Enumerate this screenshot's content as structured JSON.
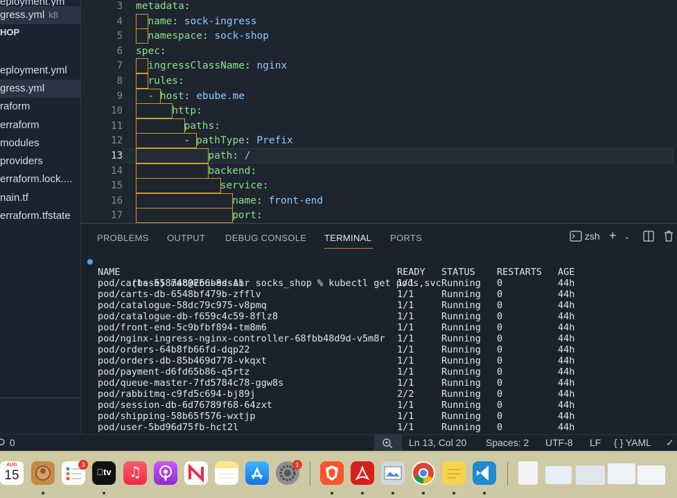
{
  "sidebar": {
    "section": "HOP",
    "items": [
      {
        "label": "eployment.ym",
        "active": false
      },
      {
        "label": "gress.yml",
        "tag": "k8",
        "active": true
      },
      {
        "label": "eployment.yml",
        "active": false
      },
      {
        "label": "gress.yml",
        "active": true
      },
      {
        "label": "raform",
        "active": false
      },
      {
        "label": "erraform",
        "active": false
      },
      {
        "label": "modules",
        "active": false
      },
      {
        "label": "providers",
        "active": false
      },
      {
        "label": "erraform.lock....",
        "active": false
      },
      {
        "label": "nain.tf",
        "active": false
      },
      {
        "label": "erraform.tfstate",
        "active": false
      }
    ]
  },
  "editor": {
    "line_numbers": [
      "3",
      "4",
      "5",
      "6",
      "7",
      "8",
      "9",
      "10",
      "11",
      "12",
      "13",
      "14",
      "15",
      "16",
      "17"
    ],
    "current_line": "13",
    "lines": [
      {
        "prefix": "",
        "key": "metadata",
        "value": ""
      },
      {
        "prefix": "",
        "key": "name",
        "value": "sock-ingress"
      },
      {
        "prefix": "",
        "key": "namespace",
        "value": "sock-shop"
      },
      {
        "prefix": "",
        "key": "spec",
        "value": ""
      },
      {
        "prefix": "",
        "key": "ingressClassName",
        "value": "nginx"
      },
      {
        "prefix": "",
        "key": "rules",
        "value": ""
      },
      {
        "prefix": "- ",
        "key": "host",
        "value": "ebube.me"
      },
      {
        "prefix": "",
        "key": "http",
        "value": ""
      },
      {
        "prefix": "",
        "key": "paths",
        "value": ""
      },
      {
        "prefix": "- ",
        "key": "pathType",
        "value": "Prefix"
      },
      {
        "prefix": "",
        "key": "path",
        "value": "/"
      },
      {
        "prefix": "",
        "key": "backend",
        "value": ""
      },
      {
        "prefix": "",
        "key": "service",
        "value": ""
      },
      {
        "prefix": "",
        "key": "name",
        "value": "front-end"
      },
      {
        "prefix": "",
        "key": "port",
        "value": ""
      }
    ]
  },
  "panel": {
    "tabs": [
      "PROBLEMS",
      "OUTPUT",
      "DEBUG CONSOLE",
      "TERMINAL",
      "PORTS"
    ],
    "active_tab": "TERMINAL",
    "shell": "zsh"
  },
  "terminal": {
    "prompt": "(base) mac@Ebubes-Air socks_shop % kubectl get pods,svc",
    "header": {
      "name": "NAME",
      "ready": "READY",
      "status": "STATUS",
      "restarts": "RESTARTS",
      "age": "AGE"
    },
    "rows": [
      {
        "name": "pod/carts-5587489766-8dssh",
        "ready": "1/1",
        "status": "Running",
        "restarts": "0",
        "age": "44h"
      },
      {
        "name": "pod/carts-db-6548bf479b-zfflv",
        "ready": "1/1",
        "status": "Running",
        "restarts": "0",
        "age": "44h"
      },
      {
        "name": "pod/catalogue-58dc79c975-v8pmq",
        "ready": "1/1",
        "status": "Running",
        "restarts": "0",
        "age": "44h"
      },
      {
        "name": "pod/catalogue-db-f659c4c59-8flz8",
        "ready": "1/1",
        "status": "Running",
        "restarts": "0",
        "age": "44h"
      },
      {
        "name": "pod/front-end-5c9bfbf894-tm8m6",
        "ready": "1/1",
        "status": "Running",
        "restarts": "0",
        "age": "44h"
      },
      {
        "name": "pod/nginx-ingress-nginx-controller-68fbb48d9d-v5m8r",
        "ready": "1/1",
        "status": "Running",
        "restarts": "0",
        "age": "44h"
      },
      {
        "name": "pod/orders-64b8fb66fd-dqp22",
        "ready": "1/1",
        "status": "Running",
        "restarts": "0",
        "age": "44h"
      },
      {
        "name": "pod/orders-db-85b469d778-vkqxt",
        "ready": "1/1",
        "status": "Running",
        "restarts": "0",
        "age": "44h"
      },
      {
        "name": "pod/payment-d6fd65b86-q5rtz",
        "ready": "1/1",
        "status": "Running",
        "restarts": "0",
        "age": "44h"
      },
      {
        "name": "pod/queue-master-7fd5784c78-ggw8s",
        "ready": "1/1",
        "status": "Running",
        "restarts": "0",
        "age": "44h"
      },
      {
        "name": "pod/rabbitmq-c9fd5c694-bj89j",
        "ready": "2/2",
        "status": "Running",
        "restarts": "0",
        "age": "44h"
      },
      {
        "name": "pod/session-db-6d76789f68-64zxt",
        "ready": "1/1",
        "status": "Running",
        "restarts": "0",
        "age": "44h"
      },
      {
        "name": "pod/shipping-58b65f576-wxtjp",
        "ready": "1/1",
        "status": "Running",
        "restarts": "0",
        "age": "44h"
      },
      {
        "name": "pod/user-5bd96d75fb-hct2l",
        "ready": "1/1",
        "status": "Running",
        "restarts": "0",
        "age": "44h"
      }
    ]
  },
  "statusbar": {
    "problems": "0",
    "position": "Ln 13, Col 20",
    "spaces": "Spaces: 2",
    "encoding": "UTF-8",
    "eol": "LF",
    "language": "{ } YAML"
  },
  "dock": {
    "calendar_month": "AUG",
    "calendar_day": "15",
    "reminders_badge": "3",
    "tv_label": "tv",
    "settings_badge": "1"
  }
}
